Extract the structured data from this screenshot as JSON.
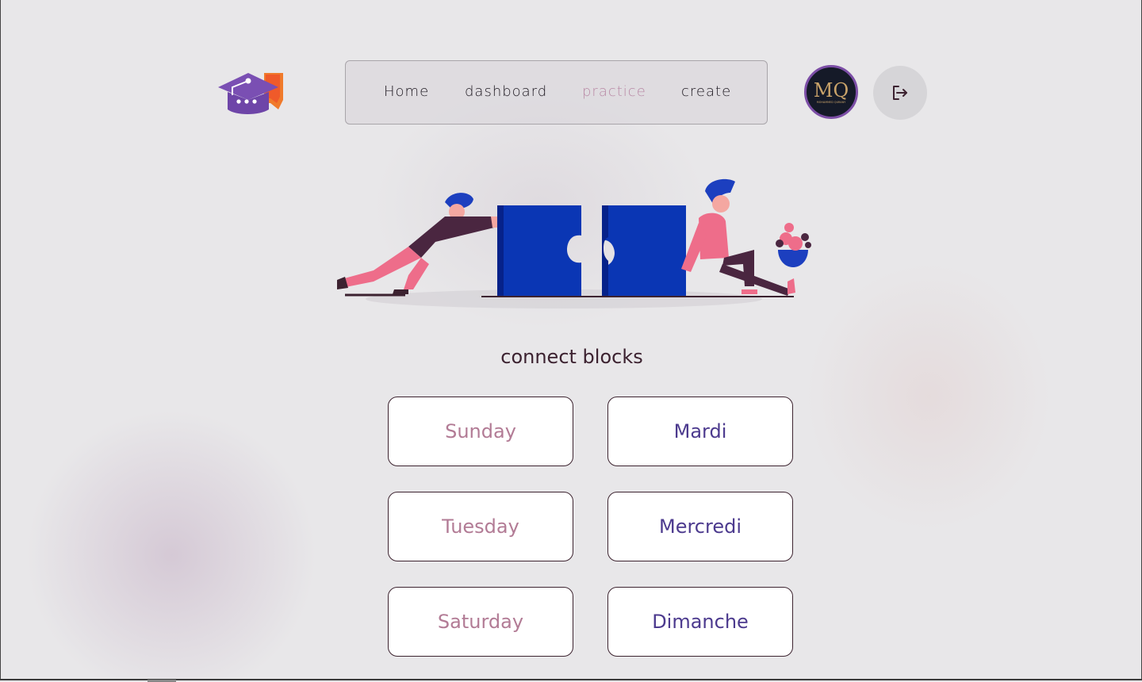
{
  "nav": {
    "items": [
      {
        "label": "Home",
        "active": false
      },
      {
        "label": "dashboard",
        "active": false
      },
      {
        "label": "practice",
        "active": true
      },
      {
        "label": "create",
        "active": false
      }
    ]
  },
  "header": {
    "logo_icon": "graduation-cap-chat-icon",
    "avatar_initials": "MQ",
    "avatar_caption": "MOHAMMED QURANY",
    "logout_icon": "logout-icon"
  },
  "hero": {
    "illustration": "people-pushing-puzzle-pieces"
  },
  "main": {
    "heading": "connect blocks",
    "left_blocks": [
      "Sunday",
      "Tuesday",
      "Saturday"
    ],
    "right_blocks": [
      "Mardi",
      "Mercredi",
      "Dimanche"
    ]
  },
  "colors": {
    "active_nav": "#b98aa6",
    "left_text": "#b27b95",
    "right_text": "#4c3a8e",
    "puzzle_blue": "#0a36b4",
    "accent_pink": "#ee6d8a"
  }
}
